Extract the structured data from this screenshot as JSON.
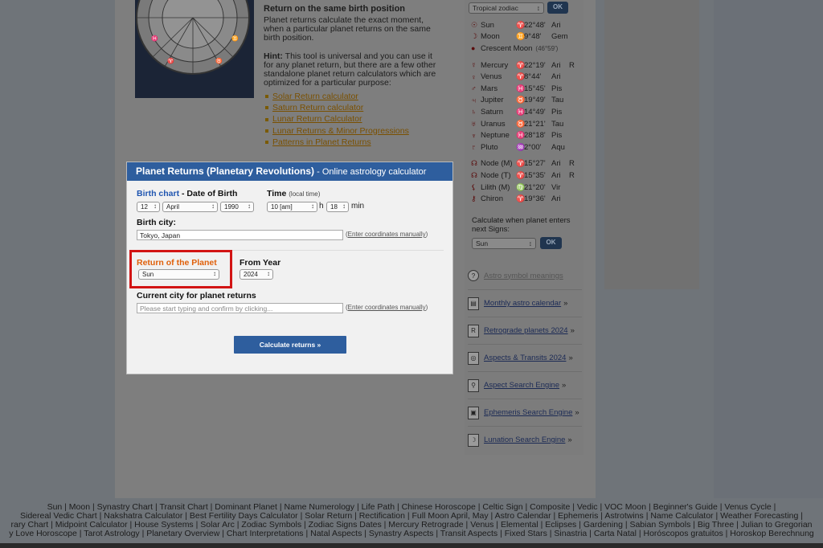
{
  "article": {
    "heading": "Return on the same birth position",
    "paragraph": "Planet returns calculate the exact moment, when a particular planet returns on the same birth position.",
    "hint_label": "Hint:",
    "hint_text": " This tool is universal and you can use it for any planet return, but there are a few other standalone planet return calculators which are optimized for a particular purpose:",
    "links": [
      "Solar Return calculator",
      "Saturn Return calculator",
      "Lunar Return Calculator",
      "Lunar Returns & Minor Progressions",
      "Patterns in Planet Returns"
    ]
  },
  "sidebar": {
    "zodiac_select": "Tropical zodiac",
    "ok_label": "OK",
    "planets": [
      {
        "glyph": "☉",
        "name": "Sun",
        "sign_glyph": "♈",
        "degree": "22°48'",
        "sign": "Ari",
        "retro": ""
      },
      {
        "glyph": "☽",
        "name": "Moon",
        "sign_glyph": "♊",
        "degree": "9°48'",
        "sign": "Gem",
        "retro": ""
      },
      {
        "glyph": "●",
        "name": "Crescent Moon",
        "sign_glyph": "",
        "degree": "(46°59')",
        "sign": "",
        "retro": ""
      },
      {
        "glyph": "☿",
        "name": "Mercury",
        "sign_glyph": "♈",
        "degree": "22°19'",
        "sign": "Ari",
        "retro": "R"
      },
      {
        "glyph": "♀",
        "name": "Venus",
        "sign_glyph": "♈",
        "degree": "8°44'",
        "sign": "Ari",
        "retro": ""
      },
      {
        "glyph": "♂",
        "name": "Mars",
        "sign_glyph": "♓",
        "degree": "15°45'",
        "sign": "Pis",
        "retro": ""
      },
      {
        "glyph": "♃",
        "name": "Jupiter",
        "sign_glyph": "♉",
        "degree": "19°49'",
        "sign": "Tau",
        "retro": ""
      },
      {
        "glyph": "♄",
        "name": "Saturn",
        "sign_glyph": "♓",
        "degree": "14°49'",
        "sign": "Pis",
        "retro": ""
      },
      {
        "glyph": "♅",
        "name": "Uranus",
        "sign_glyph": "♉",
        "degree": "21°21'",
        "sign": "Tau",
        "retro": ""
      },
      {
        "glyph": "♆",
        "name": "Neptune",
        "sign_glyph": "♓",
        "degree": "28°18'",
        "sign": "Pis",
        "retro": ""
      },
      {
        "glyph": "♇",
        "name": "Pluto",
        "sign_glyph": "♒",
        "degree": "2°00'",
        "sign": "Aqu",
        "retro": ""
      },
      {
        "glyph": "☊",
        "name": "Node (M)",
        "sign_glyph": "♈",
        "degree": "15°27'",
        "sign": "Ari",
        "retro": "R"
      },
      {
        "glyph": "☊",
        "name": "Node (T)",
        "sign_glyph": "♈",
        "degree": "15°35'",
        "sign": "Ari",
        "retro": "R"
      },
      {
        "glyph": "⚸",
        "name": "Lilith (M)",
        "sign_glyph": "♍",
        "degree": "21°20'",
        "sign": "Vir",
        "retro": ""
      },
      {
        "glyph": "⚷",
        "name": "Chiron",
        "sign_glyph": "♈",
        "degree": "19°36'",
        "sign": "Ari",
        "retro": ""
      }
    ],
    "calc_when": "Calculate when planet enters next Signs:",
    "sign_select": "Sun",
    "links": [
      {
        "icon": "?",
        "label": "Astro symbol meanings",
        "arrow": ""
      },
      {
        "icon": "▤",
        "label": "Monthly astro calendar",
        "arrow": "»"
      },
      {
        "icon": "R",
        "label": "Retrograde planets 2024",
        "arrow": "»"
      },
      {
        "icon": "◎",
        "label": "Aspects & Transits 2024",
        "arrow": "»"
      },
      {
        "icon": "⚲",
        "label": "Aspect Search Engine",
        "arrow": "»"
      },
      {
        "icon": "▣",
        "label": "Ephemeris Search Engine",
        "arrow": "»"
      },
      {
        "icon": "☽",
        "label": "Lunation Search Engine",
        "arrow": "»"
      }
    ]
  },
  "modal": {
    "title": "Planet Returns (Planetary Revolutions)",
    "subtitle": " - Online astrology calculator",
    "birth_chart": "Birth chart",
    "date_of_birth": " - Date of Birth",
    "day": "12",
    "month": "April",
    "year": "1990",
    "time_label": "Time",
    "time_hint": "(local time)",
    "hour": "10 [am]",
    "h_label": "h",
    "minute": "18",
    "min_label": "min",
    "birth_city_label": "Birth city:",
    "birth_city_value": "Tokyo, Japan",
    "enter_manually": "Enter coordinates manually",
    "return_label": "Return of the Planet",
    "planet_value": "Sun",
    "from_year_label": "From Year",
    "from_year_value": "2024",
    "current_city_label": "Current city for planet returns",
    "current_city_placeholder": "Please start typing and confirm by clicking...",
    "calculate_button": "Calculate returns »"
  },
  "footer": {
    "line1": "Sun | Moon | Synastry Chart | Transit Chart | Dominant Planet | Name Numerology | Life Path | Chinese Horoscope | Celtic Sign | Composite | Vedic | VOC Moon | Beginner's Guide | Venus Cycle |",
    "line2": "Sidereal Vedic Chart | Nakshatra Calculator | Best Fertility Days Calculator | Solar Return | Rectification | Full Moon April, May | Astro Calendar | Ephemeris | Astrotwins | Name Calculator | Weather Forecasting |",
    "line3": "rary Chart | Midpoint Calculator | House Systems | Solar Arc | Zodiac Symbols | Zodiac Signs Dates | Mercury Retrograde | Venus | Elemental | Eclipses | Gardening | Sabian Symbols | Big Three | Julian to Gregorian",
    "line4": "y Love Horoscope | Tarot Astrology | Planetary Overview | Chart Interpretations | Natal Aspects | Synastry Aspects | Transit Aspects | Fixed Stars | Sinastria | Carta Natal | Horóscopos gratuitos | Horoskop Berechnung"
  }
}
